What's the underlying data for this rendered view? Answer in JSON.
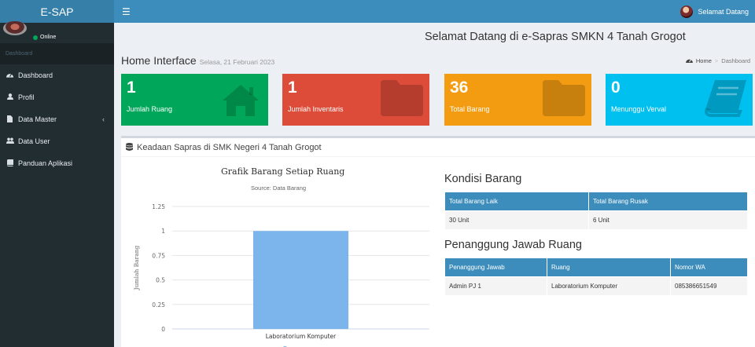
{
  "header": {
    "logo": "E-SAP",
    "menu_icon": "bars-icon",
    "username": "Selamat Datang"
  },
  "sidebar": {
    "status": "Online",
    "section": "Dashboard",
    "items": [
      {
        "label": "Dashboard",
        "icon": "dashboard-icon"
      },
      {
        "label": "Profil",
        "icon": "user-icon"
      },
      {
        "label": "Data Master",
        "icon": "file-icon"
      },
      {
        "label": "Data User",
        "icon": "users-icon"
      },
      {
        "label": "Panduan Aplikasi",
        "icon": "book-icon"
      }
    ]
  },
  "main": {
    "welcome": "Selamat Datang di e-Sapras SMKN 4 Tanah Grogot",
    "title": "Home Interface",
    "date": "Selasa, 21 Februari 2023",
    "breadcrumb": {
      "home": "Home",
      "current": "Dashboard"
    },
    "stats": [
      {
        "value": "1",
        "label": "Jumlah Ruang",
        "color": "#00a65a",
        "icon": "home-icon"
      },
      {
        "value": "1",
        "label": "Jumlah Inventaris",
        "color": "#dd4b39",
        "icon": "folder-icon"
      },
      {
        "value": "36",
        "label": "Total Barang",
        "color": "#f39c12",
        "icon": "folder-icon"
      },
      {
        "value": "0",
        "label": "Menunggu Verval",
        "color": "#00c0ef",
        "icon": "book-icon"
      }
    ],
    "panel_title": "Keadaan Sapras di SMK Negeri 4 Tanah Grogot"
  },
  "chart_data": {
    "type": "bar",
    "title": "Grafik Barang Setiap Ruang",
    "subtitle": "Source: Data Barang",
    "categories": [
      "Laboratorium Komputer"
    ],
    "series": [
      {
        "name": "Jumlah",
        "values": [
          1
        ],
        "color": "#7cb5ec"
      }
    ],
    "ylabel": "Jumlah Barang",
    "ylim": [
      0,
      1.25
    ],
    "yticks": [
      "0",
      "0.25",
      "0.5",
      "0.75",
      "1",
      "1.25"
    ],
    "grid": true,
    "legend": "bottom"
  },
  "kondisi": {
    "title": "Kondisi Barang",
    "headers": [
      "Total Barang Laik",
      "Total Barang Rusak"
    ],
    "rows": [
      [
        "30 Unit",
        "6 Unit"
      ]
    ]
  },
  "pj": {
    "title": "Penanggung Jawab Ruang",
    "headers": [
      "Penanggung Jawab",
      "Ruang",
      "Nomor WA"
    ],
    "rows": [
      [
        "Admin PJ 1",
        "Laboratorium Komputer",
        "085386651549"
      ]
    ]
  }
}
